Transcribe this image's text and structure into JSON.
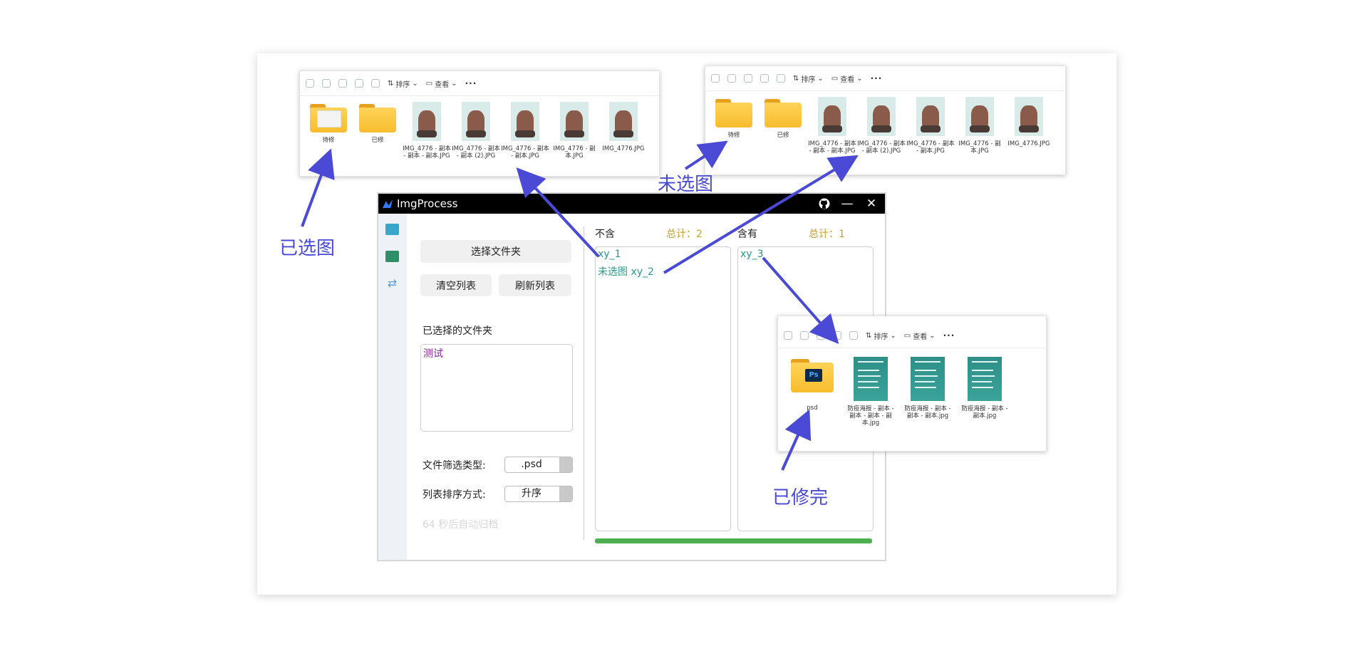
{
  "app": {
    "title": "ImgProcess",
    "select_folder_btn": "选择文件夹",
    "clear_list_btn": "清空列表",
    "refresh_list_btn": "刷新列表",
    "selected_folders_label": "已选择的文件夹",
    "selected_folders": [
      "测试"
    ],
    "filter_type_label": "文件筛选类型:",
    "filter_type_value": ".psd",
    "sort_label": "列表排序方式:",
    "sort_value": "升序",
    "status_text": "64 秒后自动归档",
    "excluded_header": "不含",
    "excluded_total": "总计：2",
    "excluded_items": [
      "xy_1",
      "未选图 xy_2"
    ],
    "included_header": "含有",
    "included_total": "总计：1",
    "included_items": [
      "xy_3"
    ],
    "progress": 1.0,
    "accent_color": "#4caf50"
  },
  "explorer_left": {
    "toolbar": {
      "sort_label": "排序",
      "view_label": "查看",
      "more": "···"
    },
    "items": [
      {
        "type": "folder-img",
        "name": "待修"
      },
      {
        "type": "folder",
        "name": "已修"
      },
      {
        "type": "image",
        "name": "IMG_4776 - 副本 - 副本 - 副本.JPG"
      },
      {
        "type": "image",
        "name": "IMG_4776 - 副本 - 副本 (2).JPG"
      },
      {
        "type": "image",
        "name": "IMG_4776 - 副本 - 副本.JPG"
      },
      {
        "type": "image",
        "name": "IMG_4776 - 副本.JPG"
      },
      {
        "type": "image",
        "name": "IMG_4776.JPG"
      }
    ]
  },
  "explorer_right": {
    "toolbar": {
      "sort_label": "排序",
      "view_label": "查看",
      "more": "···"
    },
    "items": [
      {
        "type": "folder",
        "name": "待修"
      },
      {
        "type": "folder",
        "name": "已修"
      },
      {
        "type": "image",
        "name": "IMG_4776 - 副本 - 副本 - 副本.JPG"
      },
      {
        "type": "image",
        "name": "IMG_4776 - 副本 - 副本 (2).JPG"
      },
      {
        "type": "image",
        "name": "IMG_4776 - 副本 - 副本.JPG"
      },
      {
        "type": "image",
        "name": "IMG_4776 - 副本.JPG"
      },
      {
        "type": "image",
        "name": "IMG_4776.JPG"
      }
    ]
  },
  "explorer_bottom": {
    "toolbar": {
      "sort_label": "排序",
      "view_label": "查看",
      "more": "···"
    },
    "items": [
      {
        "type": "folder-ps",
        "name": "psd"
      },
      {
        "type": "poster",
        "name": "防疫海报 - 副本 - 副本 - 副本 - 副本.jpg"
      },
      {
        "type": "poster",
        "name": "防疫海报 - 副本 - 副本 - 副本.jpg"
      },
      {
        "type": "poster",
        "name": "防疫海报 - 副本 - 副本.jpg"
      }
    ]
  },
  "annotations": {
    "selected": "已选图",
    "unselected": "未选图",
    "finished": "已修完",
    "color": "#4a4ad6"
  }
}
